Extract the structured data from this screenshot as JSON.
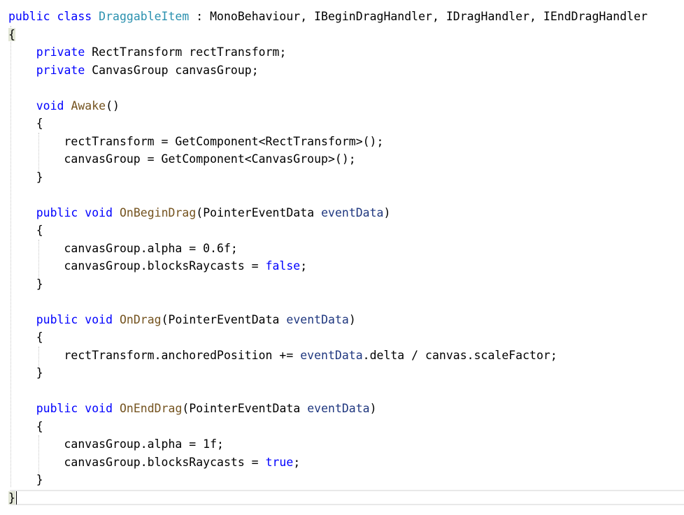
{
  "editor": {
    "language": "csharp",
    "colors": {
      "keyword": "#0000ff",
      "type": "#2b91af",
      "method": "#74531f",
      "parameter": "#1f377f",
      "plain": "#000000",
      "guide": "#c6c6c6",
      "brace_highlight": "#e2e6d6"
    },
    "lines": [
      [
        [
          "kw",
          "public"
        ],
        [
          "pl",
          " "
        ],
        [
          "kw",
          "class"
        ],
        [
          "pl",
          " "
        ],
        [
          "ty",
          "DraggableItem"
        ],
        [
          "pl",
          " : MonoBehaviour, IBeginDragHandler, IDragHandler, IEndDragHandler"
        ]
      ],
      [
        [
          "br",
          "{"
        ]
      ],
      [
        [
          "pl",
          "    "
        ],
        [
          "kw",
          "private"
        ],
        [
          "pl",
          " RectTransform rectTransform;"
        ]
      ],
      [
        [
          "pl",
          "    "
        ],
        [
          "kw",
          "private"
        ],
        [
          "pl",
          " CanvasGroup canvasGroup;"
        ]
      ],
      [],
      [
        [
          "pl",
          "    "
        ],
        [
          "kw",
          "void"
        ],
        [
          "pl",
          " "
        ],
        [
          "me",
          "Awake"
        ],
        [
          "pl",
          "()"
        ]
      ],
      [
        [
          "pl",
          "    {"
        ]
      ],
      [
        [
          "pl",
          "        rectTransform = GetComponent<RectTransform>();"
        ]
      ],
      [
        [
          "pl",
          "        canvasGroup = GetComponent<CanvasGroup>();"
        ]
      ],
      [
        [
          "pl",
          "    }"
        ]
      ],
      [],
      [
        [
          "pl",
          "    "
        ],
        [
          "kw",
          "public"
        ],
        [
          "pl",
          " "
        ],
        [
          "kw",
          "void"
        ],
        [
          "pl",
          " "
        ],
        [
          "me",
          "OnBeginDrag"
        ],
        [
          "pl",
          "(PointerEventData "
        ],
        [
          "pa",
          "eventData"
        ],
        [
          "pl",
          ")"
        ]
      ],
      [
        [
          "pl",
          "    {"
        ]
      ],
      [
        [
          "pl",
          "        canvasGroup.alpha = 0.6f;"
        ]
      ],
      [
        [
          "pl",
          "        canvasGroup.blocksRaycasts = "
        ],
        [
          "kw",
          "false"
        ],
        [
          "pl",
          ";"
        ]
      ],
      [
        [
          "pl",
          "    }"
        ]
      ],
      [],
      [
        [
          "pl",
          "    "
        ],
        [
          "kw",
          "public"
        ],
        [
          "pl",
          " "
        ],
        [
          "kw",
          "void"
        ],
        [
          "pl",
          " "
        ],
        [
          "me",
          "OnDrag"
        ],
        [
          "pl",
          "(PointerEventData "
        ],
        [
          "pa",
          "eventData"
        ],
        [
          "pl",
          ")"
        ]
      ],
      [
        [
          "pl",
          "    {"
        ]
      ],
      [
        [
          "pl",
          "        rectTransform.anchoredPosition += "
        ],
        [
          "pa",
          "eventData"
        ],
        [
          "pl",
          ".delta / canvas.scaleFactor;"
        ]
      ],
      [
        [
          "pl",
          "    }"
        ]
      ],
      [],
      [
        [
          "pl",
          "    "
        ],
        [
          "kw",
          "public"
        ],
        [
          "pl",
          " "
        ],
        [
          "kw",
          "void"
        ],
        [
          "pl",
          " "
        ],
        [
          "me",
          "OnEndDrag"
        ],
        [
          "pl",
          "(PointerEventData "
        ],
        [
          "pa",
          "eventData"
        ],
        [
          "pl",
          ")"
        ]
      ],
      [
        [
          "pl",
          "    {"
        ]
      ],
      [
        [
          "pl",
          "        canvasGroup.alpha = 1f;"
        ]
      ],
      [
        [
          "pl",
          "        canvasGroup.blocksRaycasts = "
        ],
        [
          "kw",
          "true"
        ],
        [
          "pl",
          ";"
        ]
      ],
      [
        [
          "pl",
          "    }"
        ]
      ],
      [
        [
          "br",
          "}"
        ],
        [
          "caret",
          ""
        ]
      ]
    ]
  }
}
